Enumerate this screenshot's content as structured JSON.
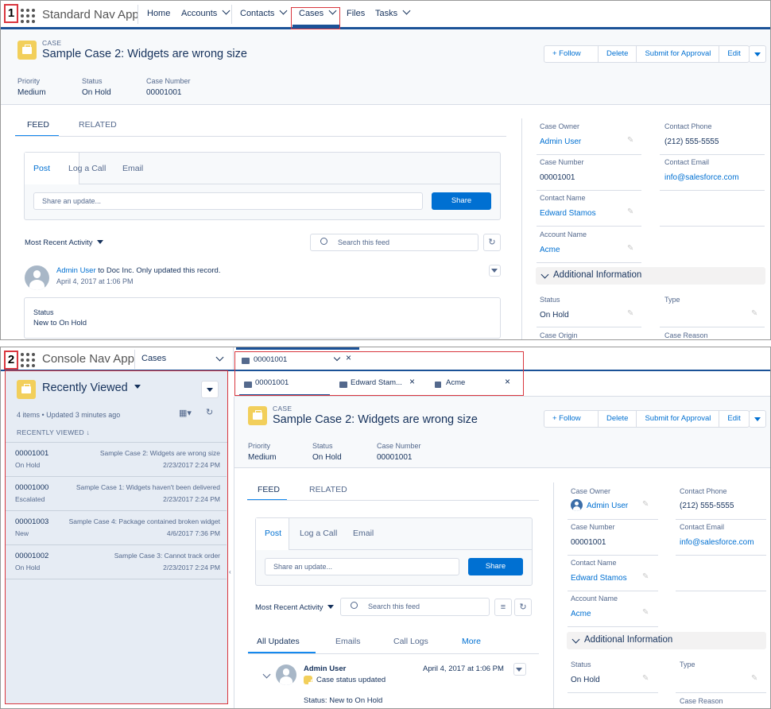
{
  "colors": {
    "accent": "#0070d2",
    "brand_bar": "#1b5297",
    "highlight": "#d9363e",
    "case_icon": "#f2cf5b"
  },
  "pane1": {
    "number": "1",
    "app_name": "Standard Nav App",
    "nav": [
      "Home",
      "Accounts",
      "Contacts",
      "Cases",
      "Files",
      "Tasks"
    ],
    "record": {
      "eyebrow": "CASE",
      "title": "Sample Case 2: Widgets are wrong size",
      "buttons": {
        "follow": "+ Follow",
        "delete": "Delete",
        "submit": "Submit for Approval",
        "edit": "Edit"
      },
      "highlights": [
        {
          "label": "Priority",
          "value": "Medium"
        },
        {
          "label": "Status",
          "value": "On Hold"
        },
        {
          "label": "Case Number",
          "value": "00001001"
        }
      ]
    },
    "feed": {
      "tabs": [
        "FEED",
        "RELATED"
      ],
      "publisher_tabs": [
        "Post",
        "Log a Call",
        "Email"
      ],
      "share_placeholder": "Share an update...",
      "share_button": "Share",
      "sort": "Most Recent Activity",
      "search_placeholder": "Search this feed",
      "post_user": "Admin User",
      "post_text": "to Doc Inc. Only updated this record.",
      "post_date": "April 4, 2017 at 1:06 PM",
      "status_label": "Status",
      "status_change": "New to On Hold"
    },
    "details": {
      "case_owner_label": "Case Owner",
      "case_owner": "Admin User",
      "contact_phone_label": "Contact Phone",
      "contact_phone": "(212) 555-5555",
      "case_number_label": "Case Number",
      "case_number": "00001001",
      "contact_email_label": "Contact Email",
      "contact_email": "info@salesforce.com",
      "contact_name_label": "Contact Name",
      "contact_name": "Edward Stamos",
      "account_name_label": "Account Name",
      "account_name": "Acme",
      "additional_info": "Additional Information",
      "status_label": "Status",
      "status": "On Hold",
      "type_label": "Type",
      "case_origin_label": "Case Origin",
      "case_reason_label": "Case Reason"
    }
  },
  "pane2": {
    "number": "2",
    "app_name": "Console Nav App",
    "object_select": "Cases",
    "workspace_tab": "00001001",
    "subtabs": [
      "00001001",
      "Edward Stam...",
      "Acme"
    ],
    "list": {
      "title": "Recently Viewed",
      "meta": "4 items • Updated 3 minutes ago",
      "column": "RECENTLY VIEWED",
      "rows": [
        {
          "number": "00001001",
          "status": "On Hold",
          "subject": "Sample Case 2: Widgets are wrong size",
          "date": "2/23/2017 2:24 PM"
        },
        {
          "number": "00001000",
          "status": "Escalated",
          "subject": "Sample Case 1: Widgets haven't been delivered",
          "date": "2/23/2017 2:24 PM"
        },
        {
          "number": "00001003",
          "status": "New",
          "subject": "Sample Case 4: Package contained broken widget",
          "date": "4/6/2017 7:36 PM"
        },
        {
          "number": "00001002",
          "status": "On Hold",
          "subject": "Sample Case 3: Cannot track order",
          "date": "2/23/2017 2:24 PM"
        }
      ]
    },
    "record": {
      "eyebrow": "CASE",
      "title": "Sample Case 2: Widgets are wrong size",
      "buttons": {
        "follow": "+ Follow",
        "delete": "Delete",
        "submit": "Submit for Approval",
        "edit": "Edit"
      },
      "highlights": [
        {
          "label": "Priority",
          "value": "Medium"
        },
        {
          "label": "Status",
          "value": "On Hold"
        },
        {
          "label": "Case Number",
          "value": "00001001"
        }
      ]
    },
    "feed": {
      "tabs": [
        "FEED",
        "RELATED"
      ],
      "publisher_tabs": [
        "Post",
        "Log a Call",
        "Email"
      ],
      "share_placeholder": "Share an update...",
      "share_button": "Share",
      "sort": "Most Recent Activity",
      "search_placeholder": "Search this feed",
      "filter_tabs": [
        "All Updates",
        "Emails",
        "Call Logs",
        "More"
      ],
      "post_user": "Admin User",
      "post_date": "April 4, 2017 at 1:06 PM",
      "post_text": "Case status updated",
      "status_line_label": "Status:",
      "status_line_value": "New to On Hold"
    },
    "details": {
      "case_owner_label": "Case Owner",
      "case_owner": "Admin User",
      "contact_phone_label": "Contact Phone",
      "contact_phone": "(212) 555-5555",
      "case_number_label": "Case Number",
      "case_number": "00001001",
      "contact_email_label": "Contact Email",
      "contact_email": "info@salesforce.com",
      "contact_name_label": "Contact Name",
      "contact_name": "Edward Stamos",
      "account_name_label": "Account Name",
      "account_name": "Acme",
      "additional_info": "Additional Information",
      "status_label": "Status",
      "status": "On Hold",
      "type_label": "Type",
      "case_reason_label": "Case Reason"
    }
  }
}
